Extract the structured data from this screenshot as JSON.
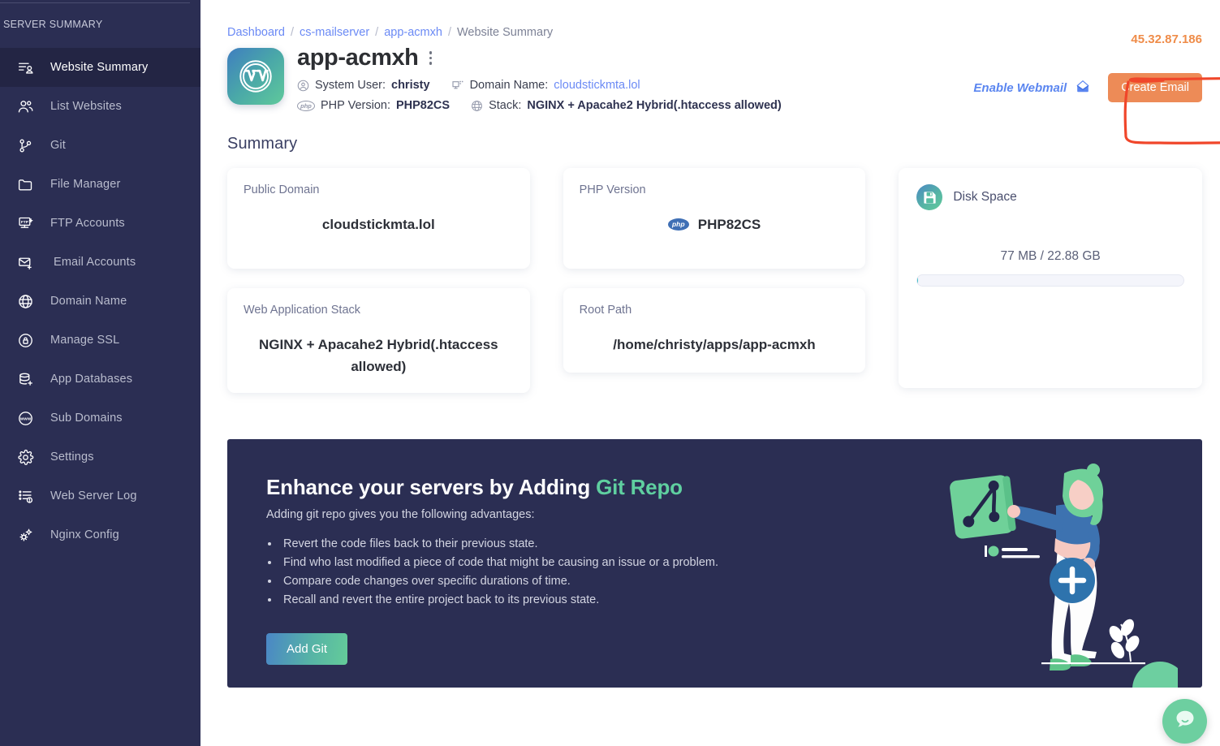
{
  "sidebar": {
    "heading": "SERVER SUMMARY",
    "items": [
      {
        "label": "Website Summary",
        "icon": "website-summary-icon",
        "active": true
      },
      {
        "label": "List Websites",
        "icon": "users-icon",
        "active": false
      },
      {
        "label": "Git",
        "icon": "git-branch-icon",
        "active": false
      },
      {
        "label": "File Manager",
        "icon": "folder-icon",
        "active": false
      },
      {
        "label": "FTP Accounts",
        "icon": "ftp-icon",
        "active": false
      },
      {
        "label": "Email Accounts",
        "icon": "envelope-plus-icon",
        "active": false
      },
      {
        "label": "Domain Name",
        "icon": "globe-icon",
        "active": false
      },
      {
        "label": "Manage SSL",
        "icon": "lock-circle-icon",
        "active": false
      },
      {
        "label": "App Databases",
        "icon": "database-plus-icon",
        "active": false
      },
      {
        "label": "Sub Domains",
        "icon": "www-circle-icon",
        "active": false
      },
      {
        "label": "Settings",
        "icon": "gear-icon",
        "active": false
      },
      {
        "label": "Web Server Log",
        "icon": "log-list-icon",
        "active": false
      },
      {
        "label": "Nginx Config",
        "icon": "gears-icon",
        "active": false
      }
    ]
  },
  "breadcrumb": {
    "items": [
      "Dashboard",
      "cs-mailserver",
      "app-acmxh",
      "Website Summary"
    ],
    "separator": "/"
  },
  "header": {
    "ip_address": "45.32.87.186",
    "app_icon": "wordpress-icon",
    "app_title": "app-acmxh",
    "kebab_icon": "more-vertical-icon",
    "meta": [
      {
        "icon": "user-circle-icon",
        "label": "System User:",
        "value": "christy",
        "link": false
      },
      {
        "icon": "monitor-icon",
        "label": "Domain Name:",
        "value": "cloudstickmta.lol",
        "link": true
      },
      {
        "icon": "php-icon",
        "label": "PHP Version:",
        "value": "PHP82CS",
        "link": false
      },
      {
        "icon": "globe-icon",
        "label": "Stack:",
        "value": "NGINX + Apacahe2 Hybrid(.htaccess allowed)",
        "link": false
      }
    ]
  },
  "actions": {
    "webmail_label": "Enable Webmail",
    "webmail_icon": "inbox-icon",
    "create_email_label": "Create Email",
    "annotation_color": "#f0462a"
  },
  "summary": {
    "title": "Summary",
    "cards": [
      {
        "label": "Public Domain",
        "value": "cloudstickmta.lol"
      },
      {
        "label": "Web Application Stack",
        "value": "NGINX + Apacahe2 Hybrid(.htaccess allowed)"
      },
      {
        "label": "PHP Version",
        "value": "PHP82CS",
        "badge": "php"
      },
      {
        "label": "Root Path",
        "value": "/home/christy/apps/app-acmxh"
      }
    ],
    "disk": {
      "icon": "disk-icon",
      "title": "Disk Space",
      "usage_text": "77 MB / 22.88 GB",
      "used": "77 MB",
      "total": "22.88 GB",
      "percent": 0.33
    }
  },
  "git_banner": {
    "heading_main": "Enhance your servers by Adding",
    "heading_accent": "Git Repo",
    "subheading": "Adding git repo gives you the following advantages:",
    "bullets": [
      "Revert the code files back to their previous state.",
      "Find who last modified a piece of code that might be causing an issue or a problem.",
      "Compare code changes over specific durations of time.",
      "Recall and revert the entire project back to its previous state."
    ],
    "button_label": "Add Git",
    "illustration": "woman-with-git-card-illustration"
  },
  "chat": {
    "icon": "chat-bubble-icon"
  },
  "colors": {
    "sidebar_bg": "#2b2e53",
    "sidebar_active_bg": "#232544",
    "accent_orange": "#ed8b57",
    "accent_green": "#5fcfa0",
    "link_blue": "#6b8af5",
    "annotation_red": "#f0462a"
  }
}
